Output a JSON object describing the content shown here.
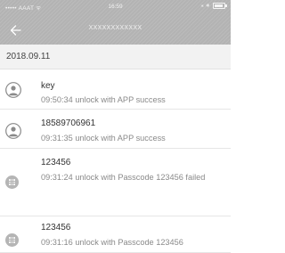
{
  "status_bar": {
    "carrier": "••••• AAAT ᯤ",
    "time": "16:59",
    "bluetooth": "⁎ ∗"
  },
  "nav": {
    "back_icon": "back-arrow-icon",
    "title": "XXXXXXXXXXXX"
  },
  "date_header": "2018.09.11",
  "records": [
    {
      "name": "key",
      "description": "09:50:34 unlock with APP success",
      "icon": "user-icon"
    },
    {
      "name": "18589706961",
      "description": "09:31:35 unlock with APP success",
      "icon": "user-icon"
    },
    {
      "name": "123456",
      "description": "09:31:24 unlock with Passcode 123456 failed",
      "icon": "passcode-icon"
    },
    {
      "name": "123456",
      "description": "09:31:16 unlock with Passcode 123456",
      "icon": "passcode-icon"
    }
  ],
  "colors": {
    "header_background": "#b3b3b3",
    "date_background": "#f2f2f2",
    "icon_gray": "#b5b5b5"
  }
}
